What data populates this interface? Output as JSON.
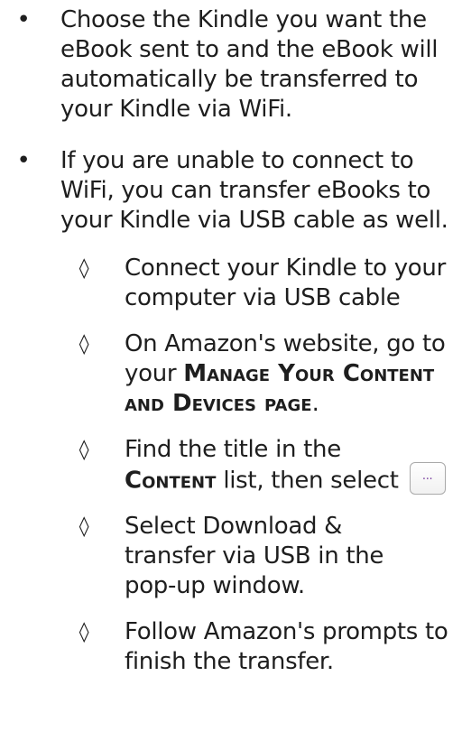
{
  "bullets": [
    {
      "marker": "•",
      "text": "Choose the Kindle you want the eBook sent to and the eBook will automatically be transferred to your Kindle via WiFi."
    },
    {
      "marker": "•",
      "text": "If you are unable to connect to WiFi, you can transfer eBooks to your Kindle via USB cable as well."
    }
  ],
  "sub_steps": {
    "marker": "◊",
    "step1": "Connect your Kindle to your computer via USB cable",
    "step2_prefix": "On Amazon's website, go to your ",
    "step2_bold_a": "Manage Your Content",
    "step2_bold_b": "and Devices page",
    "step2_suffix": ".",
    "step3_prefix": "Find the title in the ",
    "step3_bold": "Content",
    "step3_suffix": " list, then select",
    "step3_button_label": "...",
    "step4": "Select Download & transfer via USB in the pop-up window.",
    "step5": "Follow Amazon's prompts to finish the transfer."
  }
}
